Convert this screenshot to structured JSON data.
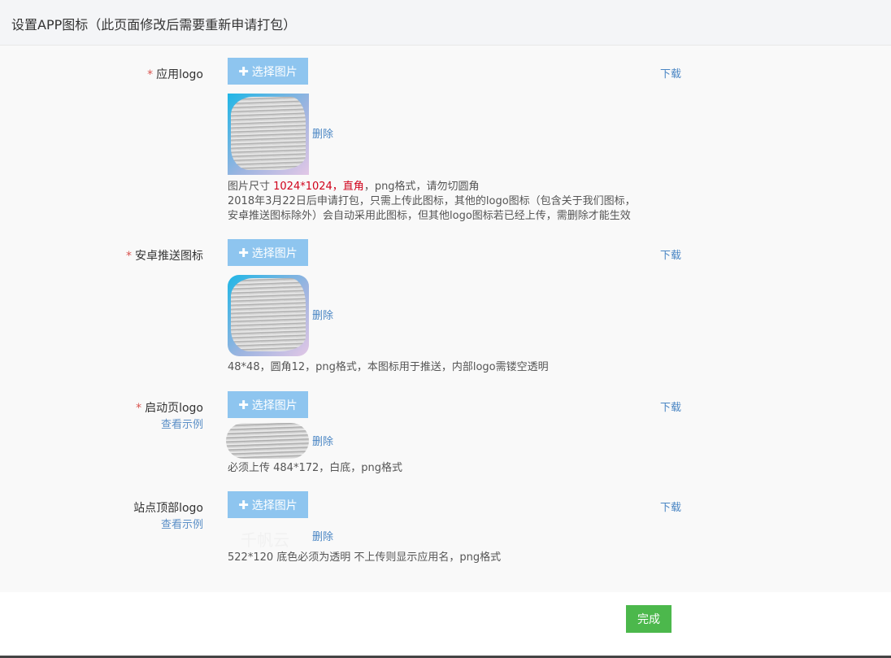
{
  "header": {
    "title": "设置APP图标（此页面修改后需要重新申请打包）"
  },
  "common": {
    "required_mark": "*",
    "choose_label": "选择图片",
    "download_label": "下载",
    "delete_label": "删除",
    "example_label": "查看示例"
  },
  "rows": [
    {
      "label": "应用logo",
      "hint_lines": [
        {
          "pre": "图片尺寸 ",
          "red": "1024*1024，直角",
          "post": "，png格式，请勿切圆角"
        },
        {
          "text": "2018年3月22日后申请打包，只需上传此图标，其他的logo图标（包含关于我们图标，"
        },
        {
          "text": "安卓推送图标除外）会自动采用此图标，但其他logo图标若已经上传，需删除才能生效"
        }
      ]
    },
    {
      "label": "安卓推送图标",
      "hint_lines": [
        {
          "text": "48*48，圆角12，png格式，本图标用于推送，内部logo需镂空透明"
        }
      ]
    },
    {
      "label": "启动页logo",
      "hint_lines": [
        {
          "text": "必须上传 484*172，白底，png格式"
        }
      ]
    },
    {
      "label": "站点顶部logo",
      "hint_lines": [
        {
          "text": "522*120 底色必须为透明 不上传则显示应用名，png格式"
        }
      ]
    }
  ],
  "watermark": "千帆云",
  "footer": {
    "done_label": "完成"
  },
  "colors": {
    "choose_button": "#8ec5ef",
    "done_button": "#4cb84c",
    "link": "#4a86c4",
    "highlight": "#d0021b"
  },
  "icons": {
    "choose": "plus-icon"
  }
}
